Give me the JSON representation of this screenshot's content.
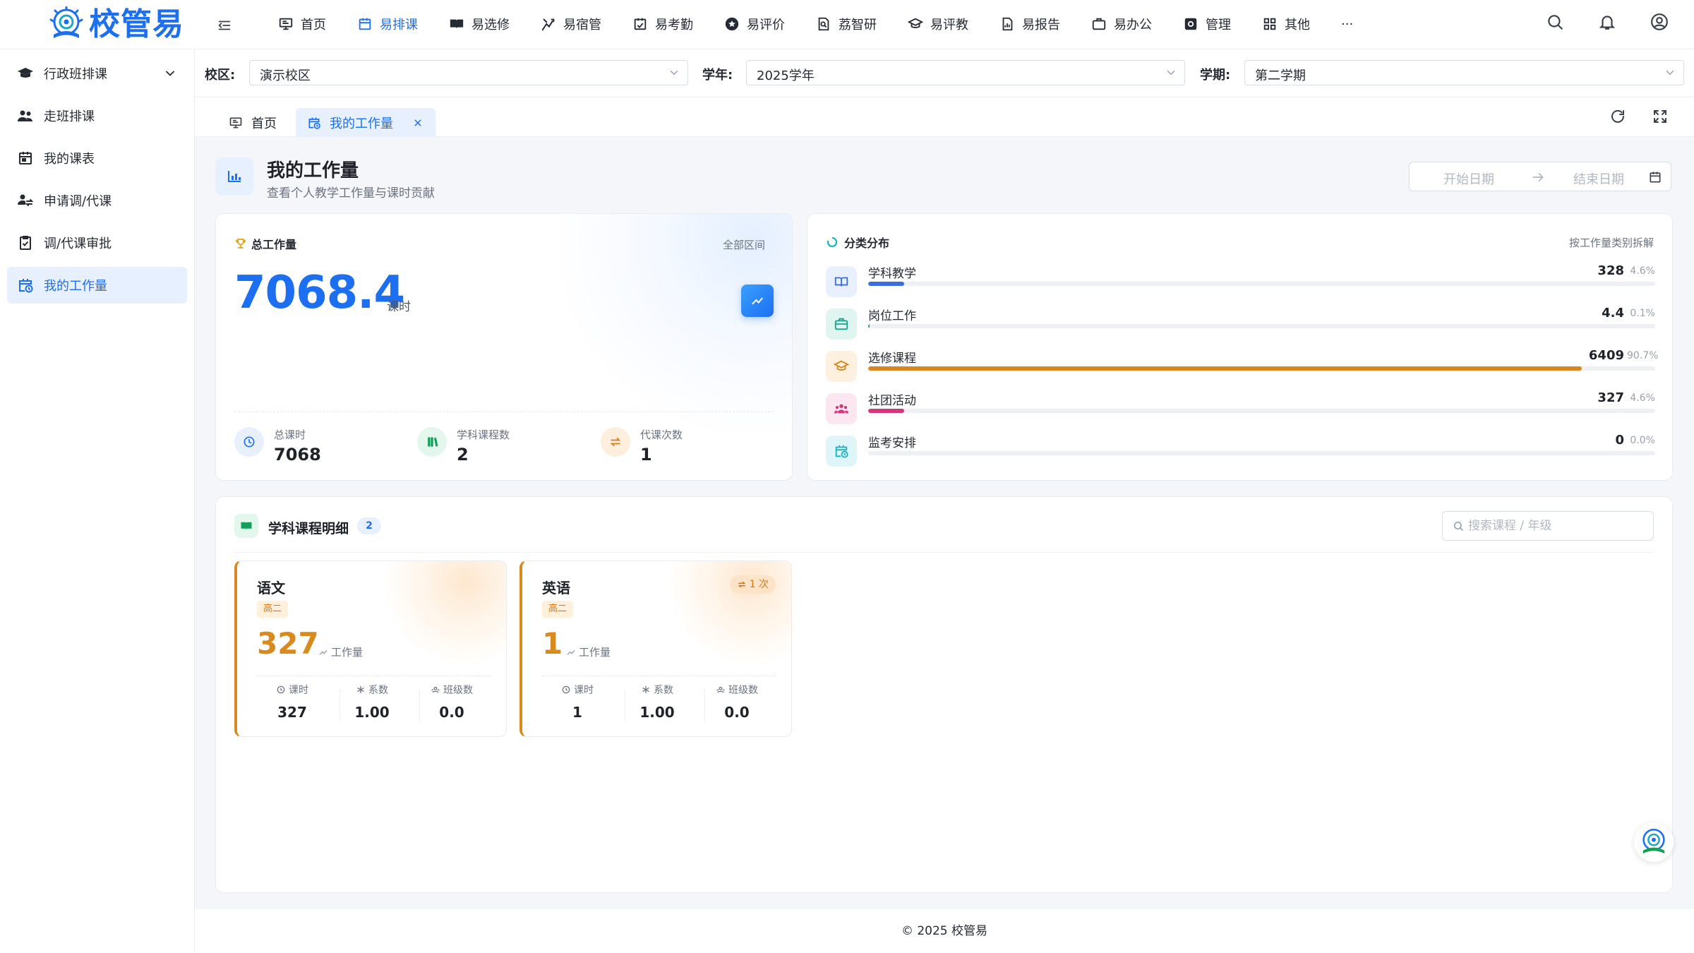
{
  "app": {
    "logo_text": "校管易"
  },
  "topnav": {
    "items": [
      {
        "label": "首页",
        "icon": "monitor-icon"
      },
      {
        "label": "易排课",
        "icon": "calendar-icon"
      },
      {
        "label": "易选修",
        "icon": "book-icon"
      },
      {
        "label": "易宿管",
        "icon": "bed-icon"
      },
      {
        "label": "易考勤",
        "icon": "calendar-check-icon"
      },
      {
        "label": "易评价",
        "icon": "star-icon"
      },
      {
        "label": "荔智研",
        "icon": "research-icon"
      },
      {
        "label": "易评教",
        "icon": "graduation-cap-icon"
      },
      {
        "label": "易报告",
        "icon": "report-icon"
      },
      {
        "label": "易办公",
        "icon": "briefcase-icon"
      },
      {
        "label": "管理",
        "icon": "settings-icon"
      },
      {
        "label": "其他",
        "icon": "grid-icon"
      }
    ],
    "more_label": "···",
    "active_index": 1
  },
  "sidebar": {
    "items": [
      {
        "label": "行政班排课",
        "icon": "graduation-cap-icon"
      },
      {
        "label": "走班排课",
        "icon": "users-icon"
      },
      {
        "label": "我的课表",
        "icon": "calendar-icon"
      },
      {
        "label": "申请调/代课",
        "icon": "swap-users-icon"
      },
      {
        "label": "调/代课审批",
        "icon": "clipboard-check-icon"
      },
      {
        "label": "我的工作量",
        "icon": "calendar-clock-icon"
      }
    ],
    "active_index": 5
  },
  "filters": {
    "campus_label": "校区:",
    "campus_value": "演示校区",
    "year_label": "学年:",
    "year_value": "2025学年",
    "term_label": "学期:",
    "term_value": "第二学期"
  },
  "tabs": {
    "home_label": "首页",
    "active_label": "我的工作量"
  },
  "page": {
    "title": "我的工作量",
    "subtitle": "查看个人教学工作量与课时贡献",
    "start_date_placeholder": "开始日期",
    "end_date_placeholder": "结束日期"
  },
  "total": {
    "title": "总工作量",
    "range_label": "全部区间",
    "value": "7068.4",
    "unit": "课时",
    "stats": [
      {
        "label": "总课时",
        "value": "7068"
      },
      {
        "label": "学科课程数",
        "value": "2"
      },
      {
        "label": "代课次数",
        "value": "1"
      }
    ]
  },
  "distribution": {
    "title": "分类分布",
    "note": "按工作量类别拆解",
    "items": [
      {
        "name": "学科教学",
        "value": "328",
        "percent": "4.6%",
        "share": 0.046,
        "color": "#3b6fe0"
      },
      {
        "name": "岗位工作",
        "value": "4.4",
        "percent": "0.1%",
        "share": 0.001,
        "color": "#12a58a"
      },
      {
        "name": "选修课程",
        "value": "6409",
        "percent": "90.7%",
        "share": 0.907,
        "color": "#d9861f"
      },
      {
        "name": "社团活动",
        "value": "327",
        "percent": "4.6%",
        "share": 0.046,
        "color": "#d6357a"
      },
      {
        "name": "监考安排",
        "value": "0",
        "percent": "0.0%",
        "share": 0.0,
        "color": "#1bb1c2"
      }
    ]
  },
  "detail": {
    "title": "学科课程明细",
    "count": "2",
    "search_placeholder": "搜索课程 / 年级",
    "courses": [
      {
        "name": "语文",
        "grade": "高二",
        "value": "327",
        "value_label": "工作量",
        "stats": [
          {
            "label": "课时",
            "value": "327"
          },
          {
            "label": "系数",
            "value": "1.00"
          },
          {
            "label": "班级数",
            "value": "0.0"
          }
        ]
      },
      {
        "name": "英语",
        "grade": "高二",
        "substitute": "1 次",
        "value": "1",
        "value_label": "工作量",
        "stats": [
          {
            "label": "课时",
            "value": "1"
          },
          {
            "label": "系数",
            "value": "1.00"
          },
          {
            "label": "班级数",
            "value": "0.0"
          }
        ]
      }
    ]
  },
  "footer": {
    "copyright": "© 2025 校管易"
  }
}
